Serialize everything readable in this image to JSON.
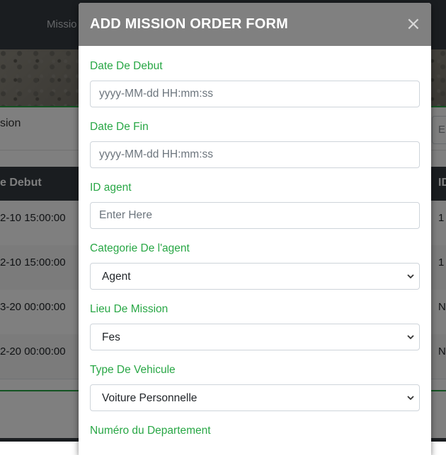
{
  "background": {
    "nav_link": "Missio",
    "filter_label": "sion",
    "filter_input_placeholder": "Er",
    "table": {
      "headers": [
        "e Debut",
        "ID"
      ],
      "rows": [
        [
          "2-10 15:00:00",
          "1"
        ],
        [
          "2-10 15:00:00",
          "1"
        ],
        [
          "3-20 00:00:00",
          "N"
        ],
        [
          "2-20 00:00:00",
          "N"
        ]
      ]
    }
  },
  "modal": {
    "title": "ADD MISSION ORDER FORM",
    "close_label": "×",
    "fields": {
      "date_debut": {
        "label": "Date De Debut",
        "placeholder": "yyyy-MM-dd HH:mm:ss"
      },
      "date_fin": {
        "label": "Date De Fin",
        "placeholder": "yyyy-MM-dd HH:mm:ss"
      },
      "id_agent": {
        "label": "ID agent",
        "placeholder": "Enter Here"
      },
      "categorie": {
        "label": "Categorie De l'agent",
        "value": "Agent"
      },
      "lieu": {
        "label": "Lieu De Mission",
        "value": "Fes"
      },
      "vehicule": {
        "label": "Type De Vehicule",
        "value": "Voiture Personnelle"
      },
      "departement": {
        "label": "Numéro du Departement"
      }
    }
  },
  "colors": {
    "label_green": "#28a745",
    "header_gray": "#808080",
    "navbar_dark": "#343a40"
  },
  "icons": {
    "close": "close-icon",
    "select_arrow": "chevron-down-icon"
  }
}
